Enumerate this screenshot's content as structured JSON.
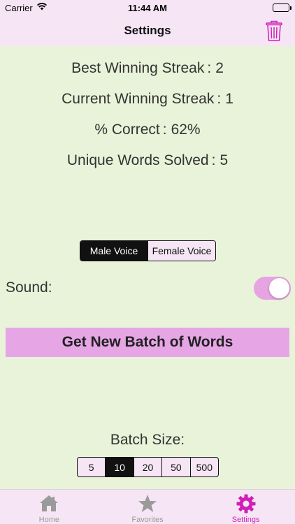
{
  "status_bar": {
    "carrier": "Carrier",
    "time": "11:44 AM"
  },
  "nav": {
    "title": "Settings",
    "icon": "trash-icon"
  },
  "stats": [
    {
      "label": "Best Winning Streak",
      "value": "2"
    },
    {
      "label": "Current Winning Streak",
      "value": "1"
    },
    {
      "label": "% Correct",
      "value": "62%"
    },
    {
      "label": "Unique Words Solved",
      "value": "5"
    }
  ],
  "voice": {
    "options": [
      "Male Voice",
      "Female Voice"
    ],
    "selected": "Male Voice"
  },
  "sound": {
    "label": "Sound:",
    "on": true
  },
  "batch_button": {
    "label": "Get New Batch of Words"
  },
  "batch_size": {
    "label": "Batch Size:",
    "options": [
      "5",
      "10",
      "20",
      "50",
      "500"
    ],
    "selected": "10"
  },
  "tabs": [
    {
      "label": "Home",
      "icon": "house-icon",
      "active": false
    },
    {
      "label": "Favorites",
      "icon": "star-icon",
      "active": false
    },
    {
      "label": "Settings",
      "icon": "gear-icon",
      "active": true
    }
  ],
  "colors": {
    "background": "#e8f3d9",
    "bar": "#f6e6f5",
    "accent": "#d11fb6",
    "button": "#e6a6e6",
    "toggle_on": "#e7a4e3"
  }
}
